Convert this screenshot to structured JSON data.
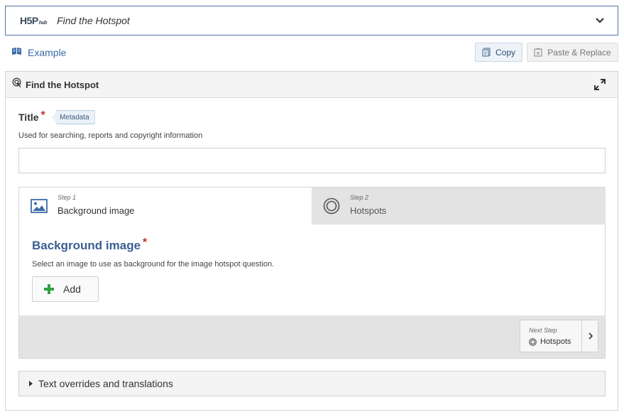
{
  "header": {
    "logo_text": "H5P",
    "logo_sub": "hub",
    "title": "Find the Hotspot",
    "toggle_icon": "chevron-down-icon"
  },
  "example": {
    "label": "Example",
    "icon": "book-icon"
  },
  "toolbar": {
    "copy_label": "Copy",
    "paste_label": "Paste & Replace"
  },
  "editor": {
    "title": "Find the Hotspot",
    "title_field": {
      "label": "Title",
      "required_mark": "*",
      "metadata_label": "Metadata",
      "description": "Used for searching, reports and copyright information",
      "value": ""
    },
    "steps": [
      {
        "step_label": "Step 1",
        "name": "Background image",
        "icon": "image-icon",
        "active": true
      },
      {
        "step_label": "Step 2",
        "name": "Hotspots",
        "icon": "target-icon",
        "active": false
      }
    ],
    "background": {
      "heading": "Background image",
      "required_mark": "*",
      "description": "Select an image to use as background for the image hotspot question.",
      "add_label": "Add"
    },
    "next": {
      "small_label": "Next Step",
      "label": "Hotspots"
    },
    "overrides_label": "Text overrides and translations"
  },
  "colors": {
    "accent_blue": "#3c5f93",
    "required_red": "#c0392b",
    "add_green": "#2ea043"
  }
}
